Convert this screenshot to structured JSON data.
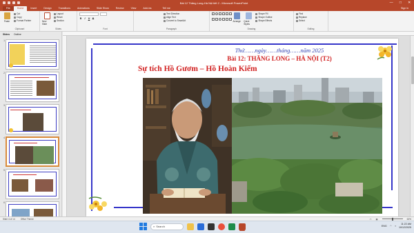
{
  "window": {
    "title": "Bài 12 Thăng Long-Hà Nội tiết 2 - Microsoft PowerPoint",
    "controls": [
      "—",
      "□",
      "✕"
    ]
  },
  "ribbon": {
    "tabs": [
      "File",
      "Home",
      "Insert",
      "Design",
      "Transitions",
      "Animations",
      "Slide Show",
      "Review",
      "View",
      "Add-ins"
    ],
    "active_tab": "Home",
    "tell_me": "Tell me",
    "sign_in": "Sign in",
    "groups": {
      "clipboard": {
        "label": "Clipboard",
        "paste": "Paste",
        "cut": "Cut",
        "copy": "Copy",
        "format_painter": "Format Painter"
      },
      "slides": {
        "label": "Slides",
        "new_slide": "New Slide",
        "layout": "Layout",
        "reset": "Reset",
        "section": "Section"
      },
      "font": {
        "label": "Font",
        "bold": "B",
        "italic": "I",
        "underline": "U",
        "strike": "S"
      },
      "paragraph": {
        "label": "Paragraph",
        "text_direction": "Text Direction",
        "align_text": "Align Text",
        "convert_smartart": "Convert to SmartArt"
      },
      "drawing": {
        "label": "Drawing",
        "arrange": "Arrange",
        "quick_styles": "Quick Styles",
        "shape_fill": "Shape Fill",
        "shape_outline": "Shape Outline",
        "shape_effects": "Shape Effects"
      },
      "editing": {
        "label": "Editing",
        "find": "Find",
        "replace": "Replace",
        "select": "Select"
      }
    }
  },
  "thumbnails": {
    "tabs": [
      "Slides",
      "Outline"
    ],
    "active_tab": "Slides",
    "slides": [
      {
        "number": "1",
        "selected": false
      },
      {
        "number": "2",
        "selected": false
      },
      {
        "number": "3",
        "selected": false
      },
      {
        "number": "4",
        "selected": true
      },
      {
        "number": "5",
        "selected": false
      },
      {
        "number": "6",
        "selected": false
      }
    ]
  },
  "slide": {
    "date_line": "Thứ……ngày……tháng……năm 2025",
    "lesson_title": "Bài 12: THĂNG LONG – HÀ NỘI (T2)",
    "story_title": "Sự tích Hồ Gươm – Hồ Hoàn Kiếm",
    "images": [
      "elder-portrait",
      "hoan-kiem-lake-aerial"
    ]
  },
  "statusbar": {
    "slide_info": "Slide 4 of 14",
    "theme": "Office Theme",
    "zoom": "63%"
  },
  "taskbar": {
    "search_placeholder": "Search",
    "time": "11:22 AM",
    "date": "10/12/2025",
    "language": "ENG"
  },
  "colors": {
    "powerpoint_accent": "#b7472a",
    "slide_border": "#3535c9",
    "title_red": "#d12020",
    "date_blue": "#2f3fb0"
  }
}
